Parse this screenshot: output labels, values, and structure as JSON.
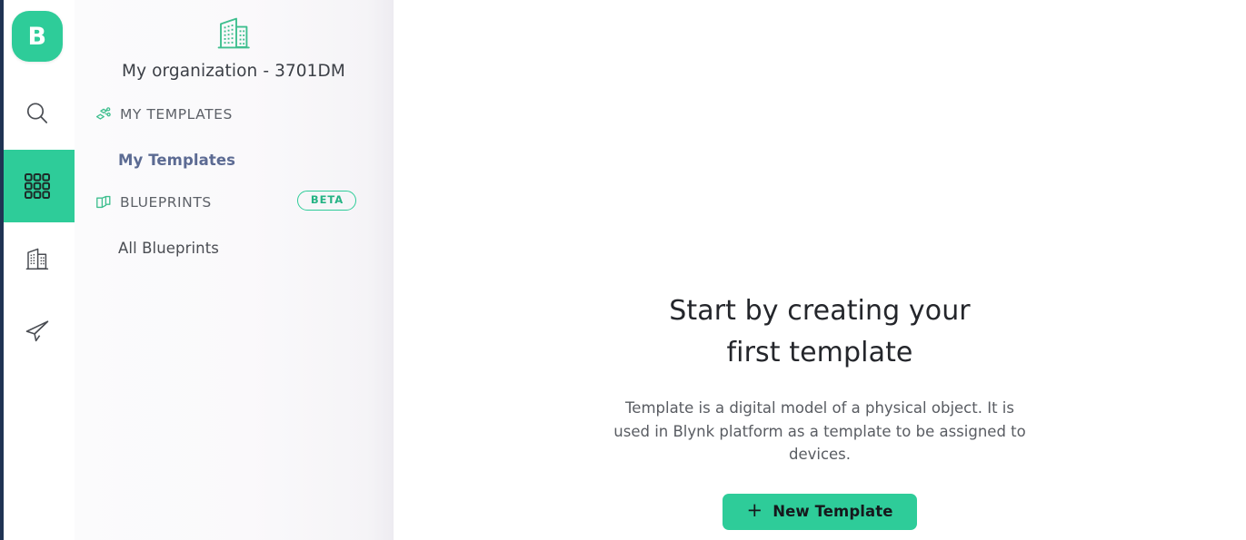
{
  "brand": {
    "logo_letter": "B",
    "accent_color": "#2ecc99",
    "edge_color": "#1f3353"
  },
  "icon_rail": {
    "items": [
      {
        "name": "search-icon",
        "label": "Search"
      },
      {
        "name": "templates-icon",
        "label": "Templates",
        "active": true
      },
      {
        "name": "organization-icon",
        "label": "Organizations"
      },
      {
        "name": "send-icon",
        "label": "Send"
      }
    ]
  },
  "panel": {
    "organization": {
      "icon": "building-icon",
      "title": "My organization - 3701DM"
    },
    "sections": [
      {
        "icon": "my-templates-icon",
        "label": "MY TEMPLATES",
        "badge": null,
        "links": [
          {
            "label": "My Templates",
            "active": true
          }
        ]
      },
      {
        "icon": "blueprints-icon",
        "label": "BLUEPRINTS",
        "badge": "BETA",
        "links": [
          {
            "label": "All Blueprints",
            "active": false
          }
        ]
      }
    ]
  },
  "main": {
    "empty_state": {
      "title": "Start by creating your\nfirst template",
      "description": "Template is a digital model of a physical object. It is used in Blynk platform as a template to be assigned to devices.",
      "button_label": "New Template",
      "button_icon": "plus-icon"
    }
  }
}
